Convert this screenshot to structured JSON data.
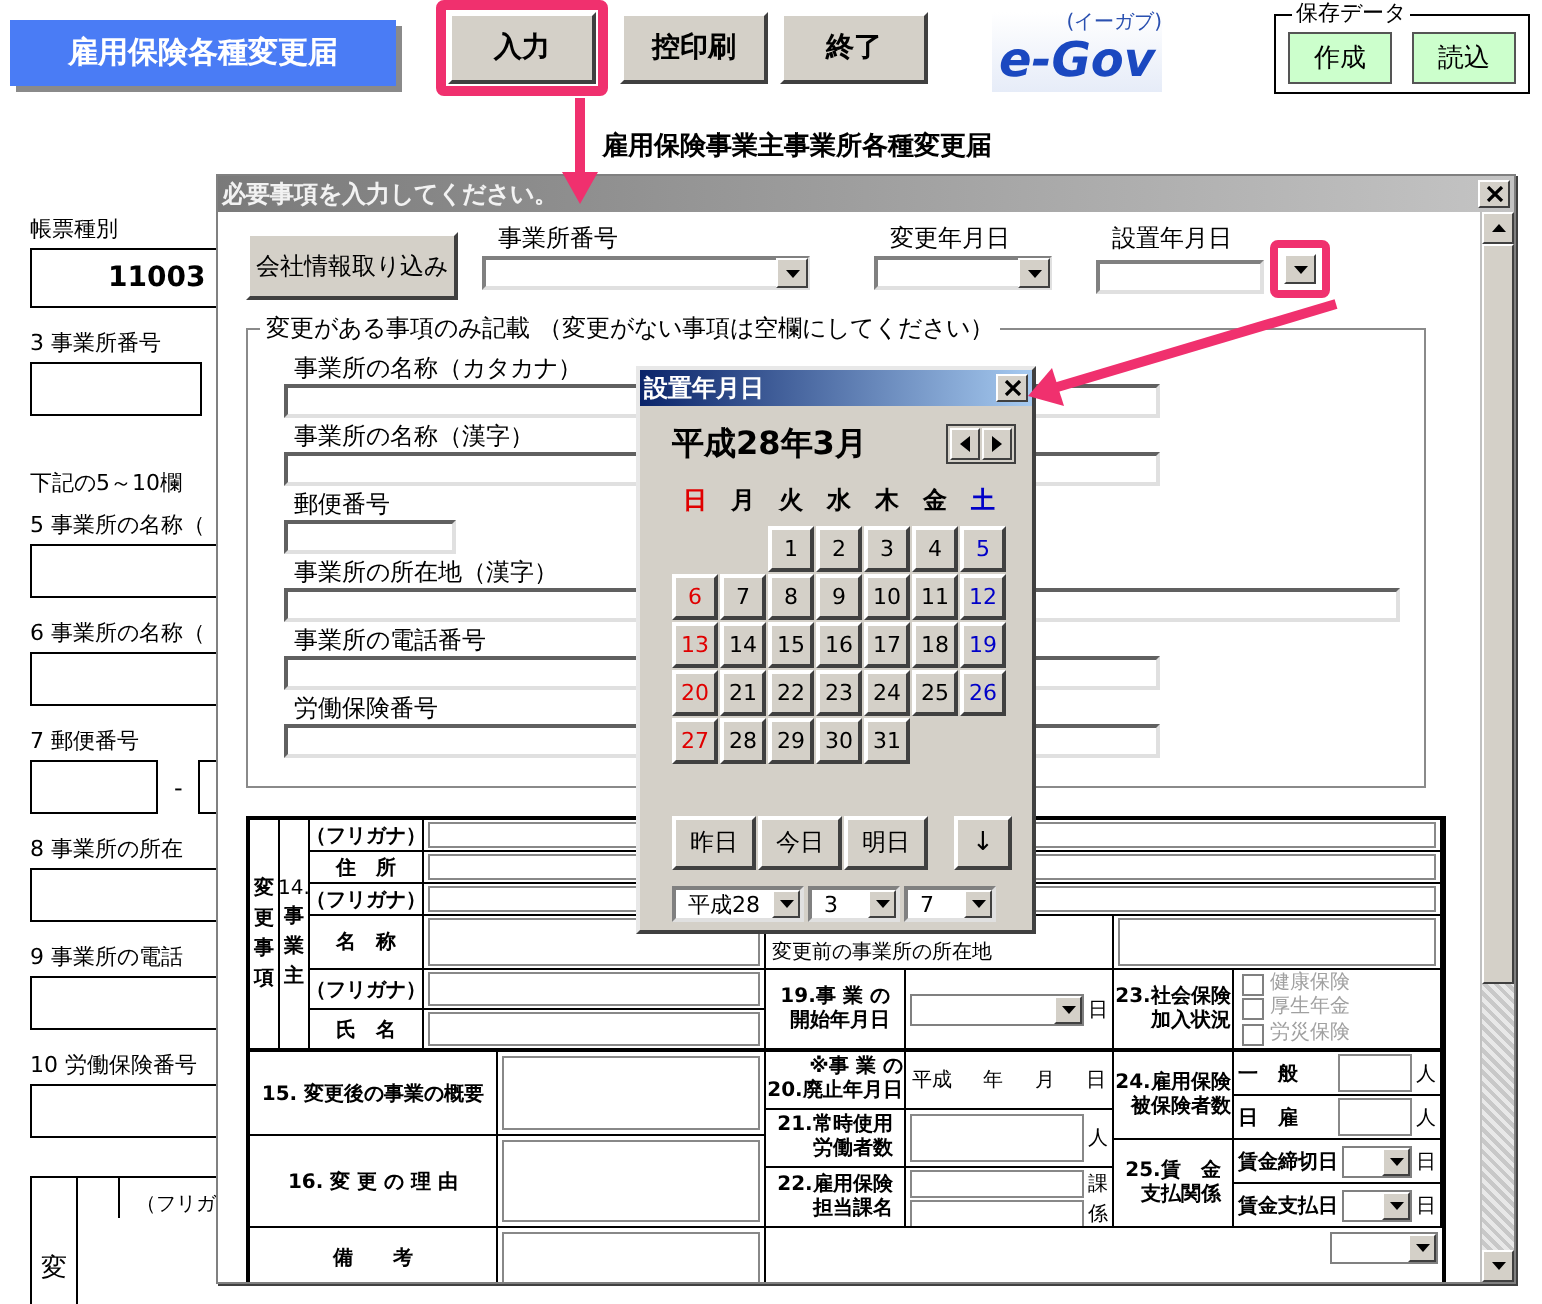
{
  "toolbar": {
    "title": "雇用保険各種変更届",
    "buttons": [
      {
        "label": "入力",
        "highlighted": true
      },
      {
        "label": "控印刷",
        "highlighted": false
      },
      {
        "label": "終了",
        "highlighted": false
      }
    ],
    "logo": {
      "text": "e-Gov",
      "ruby": "(イーガブ)"
    },
    "save_data": {
      "title": "保存データ",
      "buttons": [
        "作成",
        "読込"
      ]
    }
  },
  "form_heading": "雇用保険事業主事業所各種変更届",
  "background_form": {
    "items": [
      {
        "kind": "value",
        "label": "帳票種別",
        "value": "11003"
      },
      {
        "kind": "box",
        "label": "3 事業所番号"
      },
      {
        "kind": "note",
        "label": "下記の5～10欄"
      },
      {
        "kind": "wide",
        "label": "5 事業所の名称（"
      },
      {
        "kind": "wide",
        "label": "6 事業所の名称（"
      },
      {
        "kind": "postal",
        "label": "7 郵便番号",
        "separator": "-"
      },
      {
        "kind": "wide",
        "label": "8 事業所の所在"
      },
      {
        "kind": "wide",
        "label": "9 事業所の電話"
      },
      {
        "kind": "wide",
        "label": "10 労働保険番号"
      }
    ],
    "table_fragment": {
      "column_1": "変",
      "column_2": "（フリガ"
    }
  },
  "dialog": {
    "title": "必要事項を入力してください。",
    "import_button": "会社情報取り込み",
    "dropdowns": [
      {
        "label": "事業所番号",
        "highlighted": false
      },
      {
        "label": "変更年月日",
        "highlighted": false
      },
      {
        "label": "設置年月日",
        "highlighted": true
      }
    ],
    "group": {
      "title": "変更がある事項のみ記載 （変更がない事項は空欄にしてください）",
      "fields": [
        {
          "label": "事業所の名称（カタカナ）",
          "kind": "medium"
        },
        {
          "label": "事業所の名称（漢字）",
          "kind": "medium"
        },
        {
          "label": "郵便番号",
          "kind": "short"
        },
        {
          "label": "事業所の所在地（漢字）",
          "kind": "long"
        },
        {
          "label": "事業所の電話番号",
          "kind": "medium"
        },
        {
          "label": "労働保険番号",
          "kind": "medium"
        }
      ]
    },
    "table": {
      "side_label": "変更事項",
      "section_number": "14.",
      "section_label": "事業主",
      "rows_14": [
        {
          "label": "（フリガナ）"
        },
        {
          "label": "住　所"
        },
        {
          "label": "（フリガナ）"
        },
        {
          "label": "名　称"
        },
        {
          "label": "（フリガナ）"
        },
        {
          "label": "氏　名"
        }
      ],
      "previous_address_label": "変更前の事業所の所在地",
      "item_19": {
        "label_lines": [
          "19.事 業 の",
          "開始年月日"
        ],
        "unit": "日"
      },
      "item_20": {
        "label_lines": [
          "※事 業 の",
          "20.廃止年月日"
        ],
        "parts": [
          "平成",
          "年",
          "月",
          "日"
        ]
      },
      "item_21": {
        "label_lines": [
          "21.常時使用",
          "労働者数"
        ],
        "unit": "人"
      },
      "item_22": {
        "label_lines": [
          "22.雇用保険",
          "担当課名"
        ],
        "units": [
          "課",
          "係"
        ]
      },
      "item_23": {
        "label_lines": [
          "23.社会保険",
          "加入状況"
        ],
        "options": [
          {
            "label": "健康保険",
            "checked": false,
            "disabled": true
          },
          {
            "label": "厚生年金",
            "checked": false,
            "disabled": true
          },
          {
            "label": "労災保険",
            "checked": false,
            "disabled": true
          }
        ]
      },
      "item_24": {
        "label_lines": [
          "24.雇用保険",
          "被保険者数"
        ],
        "rows": [
          {
            "label": "一　般",
            "unit": "人"
          },
          {
            "label": "日　雇",
            "unit": "人"
          }
        ]
      },
      "item_25": {
        "label_lines": [
          "25.賃　金",
          "支払関係"
        ],
        "rows": [
          {
            "label": "賃金締切日",
            "unit": "日"
          },
          {
            "label": "賃金支払日",
            "unit": "日"
          }
        ]
      },
      "item_15": "15. 変更後の事業の概要",
      "item_16": "16. 変 更 の 理 由",
      "remarks": "備　　考"
    }
  },
  "calendar": {
    "title": "設置年月日",
    "month": "平成28年3月",
    "weekdays": [
      {
        "label": "日",
        "kind": "sunday"
      },
      {
        "label": "月",
        "kind": "weekday"
      },
      {
        "label": "火",
        "kind": "weekday"
      },
      {
        "label": "水",
        "kind": "weekday"
      },
      {
        "label": "木",
        "kind": "weekday"
      },
      {
        "label": "金",
        "kind": "weekday"
      },
      {
        "label": "土",
        "kind": "saturday"
      }
    ],
    "weeks": [
      {
        "kind": "first",
        "days": [
          "1",
          "2",
          "3",
          "4",
          "5"
        ]
      },
      {
        "kind": "full",
        "days": [
          "6",
          "7",
          "8",
          "9",
          "10",
          "11",
          "12"
        ]
      },
      {
        "kind": "full",
        "days": [
          "13",
          "14",
          "15",
          "16",
          "17",
          "18",
          "19"
        ]
      },
      {
        "kind": "full",
        "days": [
          "20",
          "21",
          "22",
          "23",
          "24",
          "25",
          "26"
        ]
      },
      {
        "kind": "last",
        "days": [
          "27",
          "28",
          "29",
          "30",
          "31"
        ]
      }
    ],
    "shortcuts": [
      "昨日",
      "今日",
      "明日"
    ],
    "down_button": "↓",
    "selects": [
      "平成28",
      "3",
      "7"
    ]
  }
}
